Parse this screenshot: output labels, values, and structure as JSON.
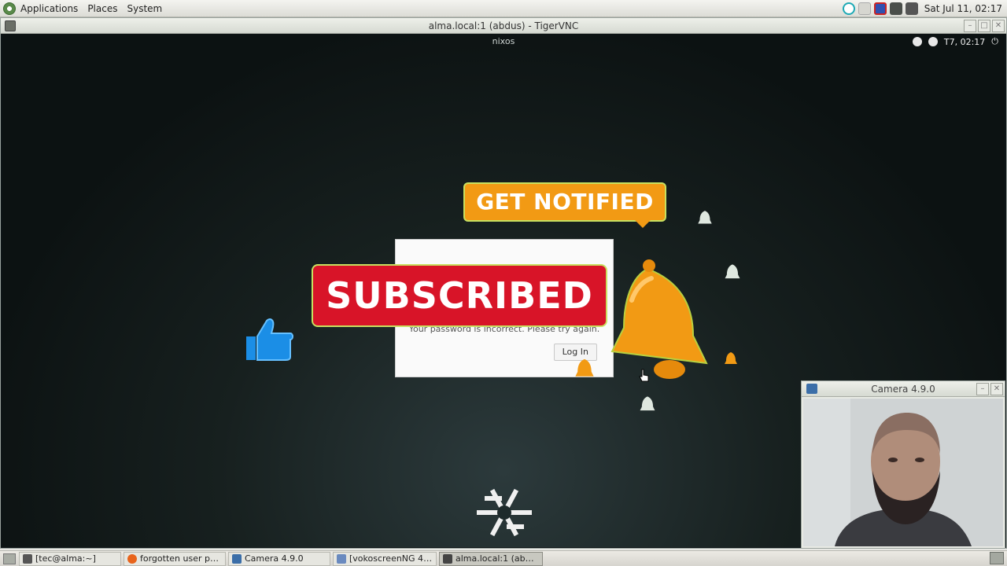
{
  "top_panel": {
    "menus": [
      "Applications",
      "Places",
      "System"
    ],
    "clock": "Sat Jul 11, 02:17"
  },
  "vnc": {
    "title": "alma.local:1 (abdus) - TigerVNC",
    "remote_hostname": "nixos",
    "remote_clock": "T7, 02:17",
    "login": {
      "error": "Your password is incorrect. Please try again.",
      "login_button": "Log In"
    }
  },
  "overlays": {
    "get_notified": "GET NOTIFIED",
    "subscribed": "SUBSCRIBED",
    "colors": {
      "orange": "#f29a14",
      "red": "#d81428",
      "blue": "#1b8ee6"
    }
  },
  "camera_window": {
    "title": "Camera 4.9.0"
  },
  "taskbar": {
    "tasks": [
      {
        "label": "[tec@alma:~]",
        "icon": "terminal-icon",
        "width": 130
      },
      {
        "label": "forgotten user pass...",
        "icon": "firefox-icon",
        "width": 130
      },
      {
        "label": "Camera 4.9.0",
        "icon": "camera-icon",
        "width": 130
      },
      {
        "label": "[vokoscreenNG 4.9.0]",
        "icon": "vokoscreen-icon",
        "width": 132
      },
      {
        "label": "alma.local:1 (abdus) ...",
        "icon": "vnc-icon",
        "width": 132,
        "active": true
      }
    ]
  }
}
